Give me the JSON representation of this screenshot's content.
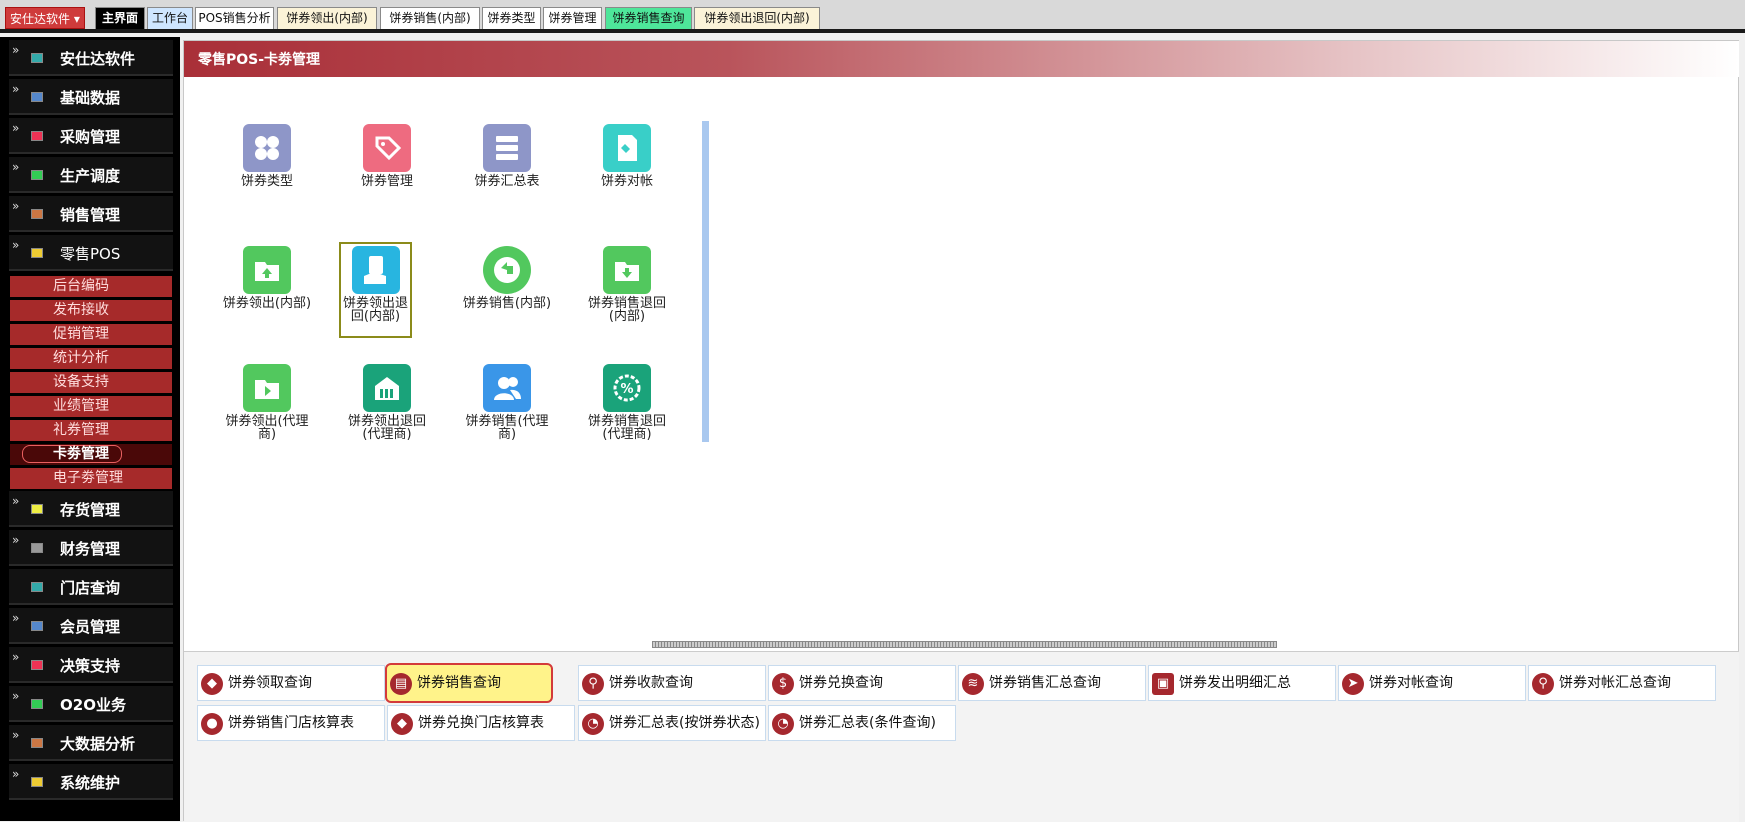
{
  "app": {
    "brand": "安仕达软件"
  },
  "tabs": [
    {
      "label": "主界面"
    },
    {
      "label": "工作台"
    },
    {
      "label": "POS销售分析"
    },
    {
      "label": "饼券领出(内部)"
    },
    {
      "label": "饼券销售(内部)"
    },
    {
      "label": "饼券类型"
    },
    {
      "label": "饼券管理"
    },
    {
      "label": "饼券销售查询"
    },
    {
      "label": "饼券领出退回(内部)"
    }
  ],
  "colors": {
    "active_tab_bg": "#000000",
    "primary_tab_bg": "#cfe6ff",
    "secondary_tab_bg": "#fbf3d8",
    "highlight_tab_bg": "#4ee69a",
    "title_bar": "#a92f38",
    "submenu_bg": "#a62a2a",
    "query_highlight": "#fff38a"
  },
  "sidebar": {
    "items": [
      {
        "label": "安仕达软件",
        "icon": "cube-icon",
        "expanded": false
      },
      {
        "label": "基础数据",
        "icon": "database-icon",
        "expanded": false
      },
      {
        "label": "采购管理",
        "icon": "cart-icon",
        "expanded": false
      },
      {
        "label": "生产调度",
        "icon": "factory-icon",
        "expanded": false
      },
      {
        "label": "销售管理",
        "icon": "sales-icon",
        "expanded": false
      },
      {
        "label": "零售POS",
        "icon": "pos-icon",
        "expanded": true
      },
      {
        "label": "存货管理",
        "icon": "warehouse-icon",
        "expanded": false
      },
      {
        "label": "财务管理",
        "icon": "finance-icon",
        "expanded": false
      },
      {
        "label": "门店查询",
        "icon": "store-icon",
        "expanded": false
      },
      {
        "label": "会员管理",
        "icon": "member-icon",
        "expanded": false
      },
      {
        "label": "决策支持",
        "icon": "decision-icon",
        "expanded": false
      },
      {
        "label": "O2O业务",
        "icon": "o2o-icon",
        "expanded": false
      },
      {
        "label": "大数据分析",
        "icon": "bigdata-icon",
        "expanded": false
      },
      {
        "label": "系统维护",
        "icon": "system-icon",
        "expanded": false
      }
    ],
    "submenu": [
      "后台编码",
      "发布接收",
      "促销管理",
      "统计分析",
      "设备支持",
      "业绩管理",
      "礼券管理",
      "卡劵管理",
      "电子劵管理"
    ],
    "active_submenu": "卡劵管理"
  },
  "page": {
    "title": "零售POS-卡劵管理"
  },
  "tiles": [
    {
      "label": "饼券类型",
      "icon": "grid-icon",
      "color": "#8e96c8"
    },
    {
      "label": "饼券管理",
      "icon": "tag-icon",
      "color": "#ee6b80"
    },
    {
      "label": "饼券汇总表",
      "icon": "server-icon",
      "color": "#8e96c8"
    },
    {
      "label": "饼券对帐",
      "icon": "pin-document-icon",
      "color": "#39cfc8"
    },
    {
      "label": "饼券领出(内部)",
      "icon": "folder-upload-icon",
      "color": "#52c85e"
    },
    {
      "label": "饼券领出退回(内部)",
      "icon": "money-hand-icon",
      "color": "#28b5e0",
      "selected": true
    },
    {
      "label": "饼券销售(内部)",
      "icon": "return-arrow-icon",
      "color": "#52c85e"
    },
    {
      "label": "饼券销售退回(内部)",
      "icon": "folder-download-icon",
      "color": "#52c85e"
    },
    {
      "label": "饼券领出(代理商)",
      "icon": "folder-refresh-icon",
      "color": "#52c85e"
    },
    {
      "label": "饼券领出退回(代理商)",
      "icon": "building-icon",
      "color": "#1aa37a"
    },
    {
      "label": "饼券销售(代理商)",
      "icon": "users-icon",
      "color": "#3a96e8"
    },
    {
      "label": "饼券销售退回(代理商)",
      "icon": "percent-gear-icon",
      "color": "#1aa37a"
    }
  ],
  "queries": [
    {
      "label": "饼券领取查询",
      "icon": "tag-icon"
    },
    {
      "label": "饼券销售查询",
      "icon": "clipboard-icon",
      "highlighted": true
    },
    {
      "label": "饼券收款查询",
      "icon": "search-icon"
    },
    {
      "label": "饼券兑换查询",
      "icon": "dollar-icon"
    },
    {
      "label": "饼券销售汇总查询",
      "icon": "layers-icon"
    },
    {
      "label": "饼券发出明细汇总",
      "icon": "id-card-icon"
    },
    {
      "label": "饼券对帐查询",
      "icon": "send-icon"
    },
    {
      "label": "饼券对帐汇总查询",
      "icon": "search-icon"
    },
    {
      "label": "饼券销售门店核算表",
      "icon": "person-icon"
    },
    {
      "label": "饼券兑换门店核算表",
      "icon": "tag-icon"
    },
    {
      "label": "饼券汇总表(按饼券状态)",
      "icon": "pie-icon"
    },
    {
      "label": "饼券汇总表(条件查询)",
      "icon": "pie-icon"
    }
  ]
}
